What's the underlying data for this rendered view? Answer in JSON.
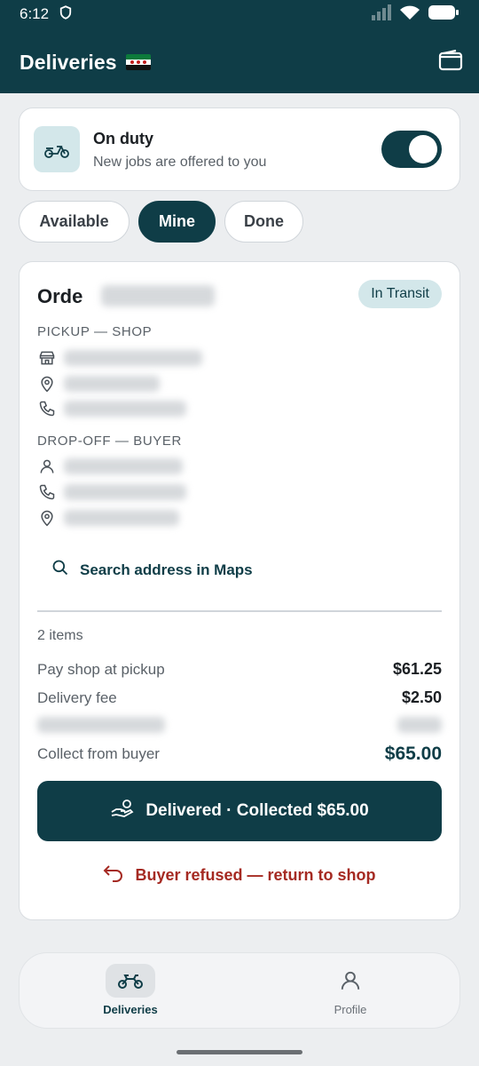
{
  "status_bar": {
    "time": "6:12"
  },
  "app_bar": {
    "title": "Deliveries"
  },
  "duty": {
    "title": "On duty",
    "subtitle": "New jobs are offered to you",
    "enabled": true
  },
  "tabs": [
    {
      "label": "Available",
      "active": false
    },
    {
      "label": "Mine",
      "active": true
    },
    {
      "label": "Done",
      "active": false
    }
  ],
  "order": {
    "title_prefix": "Orde",
    "status": "In Transit",
    "pickup_heading": "PICKUP — SHOP",
    "dropoff_heading": "DROP-OFF — BUYER",
    "search_label": "Search address in Maps",
    "items_count": "2 items",
    "pay_shop_label": "Pay shop at pickup",
    "pay_shop_value": "$61.25",
    "delivery_fee_label": "Delivery fee",
    "delivery_fee_value": "$2.50",
    "collect_label": "Collect from buyer",
    "collect_value": "$65.00",
    "primary_action": "Delivered · Collected $65.00",
    "secondary_action": "Buyer refused — return to shop"
  },
  "bottom_nav": [
    {
      "label": "Deliveries",
      "icon": "motorbike-icon",
      "active": true
    },
    {
      "label": "Profile",
      "icon": "person-icon",
      "active": false
    }
  ],
  "colors": {
    "primary": "#0f3d47",
    "badge_bg": "#d3e7ea",
    "danger": "#a52a22",
    "background": "#eceef0"
  }
}
